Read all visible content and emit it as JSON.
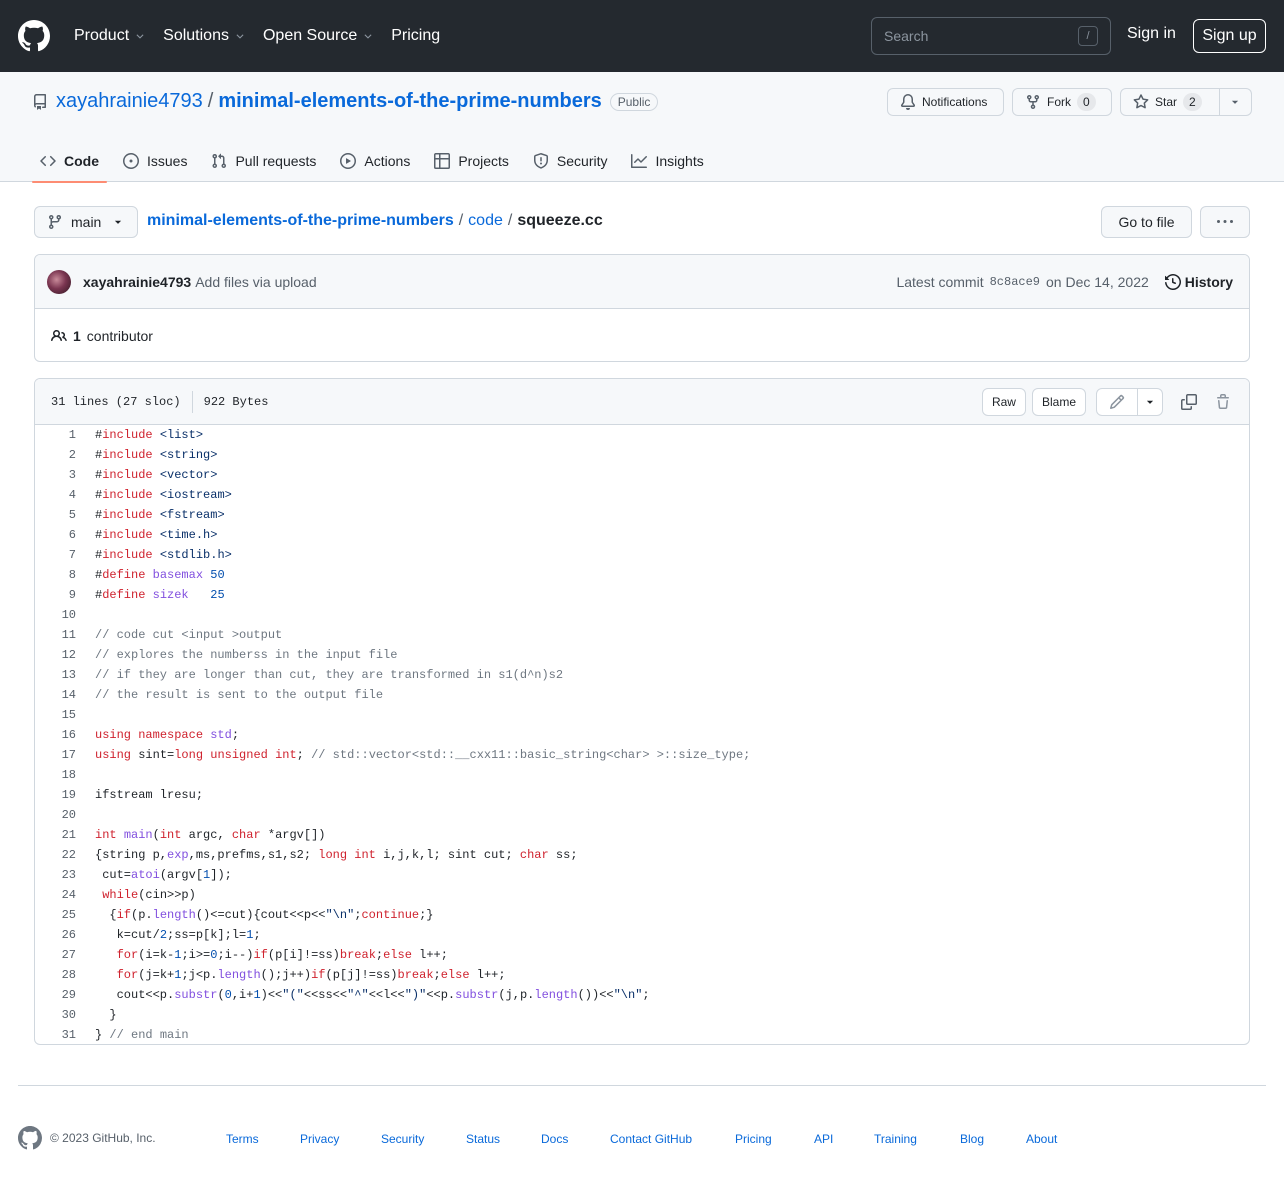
{
  "header": {
    "nav": [
      {
        "label": "Product",
        "dropdown": true
      },
      {
        "label": "Solutions",
        "dropdown": true
      },
      {
        "label": "Open Source",
        "dropdown": true
      },
      {
        "label": "Pricing",
        "dropdown": false
      }
    ],
    "search_placeholder": "Search",
    "search_shortcut": "/",
    "sign_in": "Sign in",
    "sign_up": "Sign up"
  },
  "repo": {
    "owner": "xayahrainie4793",
    "separator": "/",
    "name": "minimal-elements-of-the-prime-numbers",
    "visibility": "Public",
    "notifications_label": "Notifications",
    "fork_label": "Fork",
    "fork_count": "0",
    "star_label": "Star",
    "star_count": "2"
  },
  "tabs": [
    {
      "label": "Code",
      "icon": "code-icon",
      "active": true
    },
    {
      "label": "Issues",
      "icon": "issue-icon",
      "active": false
    },
    {
      "label": "Pull requests",
      "icon": "pull-request-icon",
      "active": false
    },
    {
      "label": "Actions",
      "icon": "play-icon",
      "active": false
    },
    {
      "label": "Projects",
      "icon": "table-icon",
      "active": false
    },
    {
      "label": "Security",
      "icon": "shield-icon",
      "active": false
    },
    {
      "label": "Insights",
      "icon": "graph-icon",
      "active": false
    }
  ],
  "file_nav": {
    "branch": "main",
    "crumb_repo": "minimal-elements-of-the-prime-numbers",
    "crumb_dir": "code",
    "crumb_file": "squeeze.cc",
    "crumb_sep": "/",
    "go_to_file": "Go to file"
  },
  "commit": {
    "author": "xayahrainie4793",
    "message": "Add files via upload",
    "latest_label": "Latest commit",
    "sha": "8c8ace9",
    "date": "on Dec 14, 2022",
    "history": "History",
    "contributors_count": "1",
    "contributors_label": "contributor"
  },
  "file": {
    "lines_info": "31 lines (27 sloc)",
    "size": "922 Bytes",
    "raw": "Raw",
    "blame": "Blame"
  },
  "code_lines": [
    "#include <list>",
    "#include <string>",
    "#include <vector>",
    "#include <iostream>",
    "#include <fstream>",
    "#include <time.h>",
    "#include <stdlib.h>",
    "#define basemax 50",
    "#define sizek   25",
    "",
    "// code cut <input >output",
    "// explores the numberss in the input file",
    "// if they are longer than cut, they are transformed in s1(d^n)s2",
    "// the result is sent to the output file",
    "",
    "using namespace std;",
    "using sint=long unsigned int; // std::vector<std::__cxx11::basic_string<char> >::size_type;",
    "",
    "ifstream lresu;",
    "",
    "int main(int argc, char *argv[])",
    "{string p,exp,ms,prefms,s1,s2; long int i,j,k,l; sint cut; char ss;",
    " cut=atoi(argv[1]);",
    " while(cin>>p)",
    "  {if(p.length()<=cut){cout<<p<<\"\\n\";continue;}",
    "   k=cut/2;ss=p[k];l=1;",
    "   for(i=k-1;i>=0;i--)if(p[i]!=ss)break;else l++;",
    "   for(j=k+1;j<p.length();j++)if(p[j]!=ss)break;else l++;",
    "   cout<<p.substr(0,i+1)<<\"(\"<<ss<<\"^\"<<l<<\")\"<<p.substr(j,p.length())<<\"\\n\";",
    "  }",
    "} // end main"
  ],
  "footer": {
    "copyright": "© 2023 GitHub, Inc.",
    "links": [
      "Terms",
      "Privacy",
      "Security",
      "Status",
      "Docs",
      "Contact GitHub",
      "Pricing",
      "API",
      "Training",
      "Blog",
      "About"
    ]
  },
  "colors": {
    "header_bg": "#24292f",
    "link": "#0969da",
    "keyword": "#cf222e",
    "function": "#8250df",
    "string": "#0a3069",
    "comment": "#6e7781",
    "active_tab_underline": "#fd8c73"
  }
}
